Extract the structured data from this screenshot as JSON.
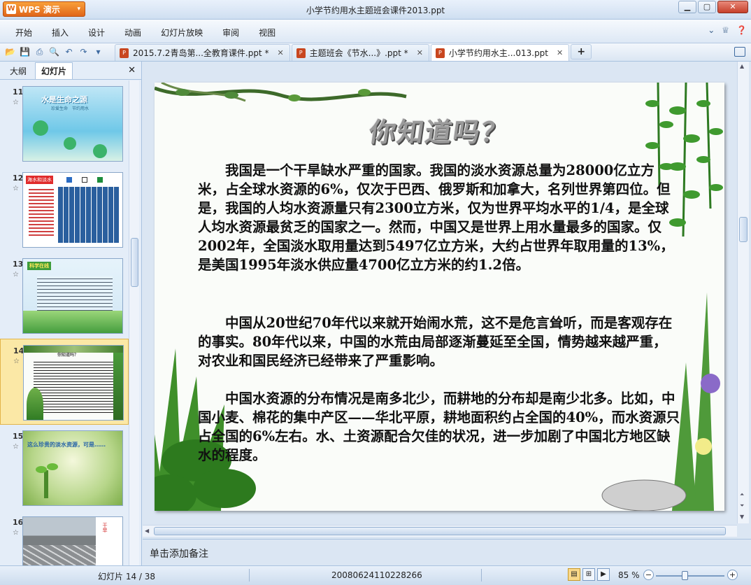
{
  "app": {
    "button_label": "WPS 演示",
    "window_title": "小学节约用水主题班会课件2013.ppt"
  },
  "window_controls": {
    "minimize": "▁",
    "maximize": "▢",
    "close": "✕"
  },
  "menu": {
    "items": [
      "开始",
      "插入",
      "设计",
      "动画",
      "幻灯片放映",
      "审阅",
      "视图"
    ]
  },
  "toolbar": {
    "tabs": [
      {
        "label": "2015.7.2青岛第...全教育课件.ppt *",
        "active": false
      },
      {
        "label": "主题班会《节水...》.ppt *",
        "active": false
      },
      {
        "label": "小学节约用水主...013.ppt",
        "active": true
      }
    ],
    "new_tab": "+"
  },
  "left_panel": {
    "tabs": [
      "大纲",
      "幻灯片"
    ],
    "active_tab": "幻灯片",
    "thumbnails": [
      {
        "number": "11",
        "title": "水是生命之源",
        "subtitle": "珍爱生命　节约用水"
      },
      {
        "number": "12",
        "label": "海水和淡水"
      },
      {
        "number": "13",
        "label": "科学在线"
      },
      {
        "number": "14",
        "label": "你知道吗？",
        "selected": true
      },
      {
        "number": "15",
        "label": "这么珍贵的淡水资源，可是……"
      },
      {
        "number": "16",
        "label": "干旱"
      }
    ]
  },
  "slide": {
    "title": "你知道吗？",
    "paragraphs": [
      "我国是一个干旱缺水严重的国家。我国的淡水资源总量为28000亿立方米，占全球水资源的6%，仅次于巴西、俄罗斯和加拿大，名列世界第四位。但是，我国的人均水资源量只有2300立方米，仅为世界平均水平的1/4，是全球人均水资源最贫乏的国家之一。然而，中国又是世界上用水量最多的国家。仅2002年，全国淡水取用量达到5497亿立方米，大约占世界年取用量的13%，是美国1995年淡水供应量4700亿立方米的约1.2倍。",
      "中国从20世纪70年代以来就开始闹水荒，这不是危言耸听，而是客观存在的事实。80年代以来，中国的水荒由局部逐渐蔓延至全国，情势越来越严重，对农业和国民经济已经带来了严重影响。",
      "中国水资源的分布情况是南多北少，而耕地的分布却是南少北多。比如，中国小麦、棉花的集中产区——华北平原，耕地面积约占全国的40%，而水资源只占全国的6%左右。水、土资源配合欠佳的状况，进一步加剧了中国北方地区缺水的程度。"
    ]
  },
  "notes": {
    "placeholder": "单击添加备注"
  },
  "status": {
    "slide_info": "幻灯片 14 / 38",
    "code": "20080624110228266",
    "zoom": "85 %",
    "zoom_level": 0.5
  },
  "colors": {
    "accent": "#e0661a",
    "chrome": "#dce8f5"
  }
}
